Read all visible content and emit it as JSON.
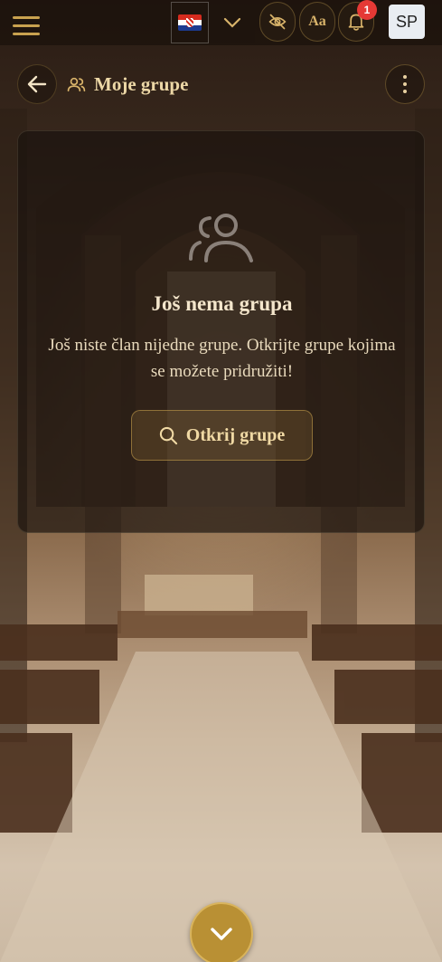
{
  "topbar": {
    "menu_icon": "hamburger-menu-icon",
    "language": {
      "flag": "croatia-flag",
      "selector_icon": "chevron-down-icon"
    },
    "visibility_icon": "eye-off-icon",
    "font_size_label": "Aa",
    "notifications": {
      "icon": "bell-icon",
      "count": "1"
    },
    "avatar_initials": "SP"
  },
  "header": {
    "back_icon": "arrow-left-icon",
    "title_icon": "users-icon",
    "title": "Moje grupe",
    "more_icon": "more-vertical-icon"
  },
  "empty_state": {
    "icon": "users-outline-icon",
    "title": "Još nema grupa",
    "description": "Još niste član nijedne grupe. Otkrijte grupe kojima se možete pridružiti!",
    "button_label": "Otkrij grupe",
    "button_icon": "search-icon"
  },
  "scroll_button_icon": "chevron-down-icon",
  "colors": {
    "accent": "#c9a24f",
    "card_bg": "#19120d",
    "text_light": "#f4e6cc",
    "badge": "#e53935",
    "scroll_button": "#b99034"
  }
}
